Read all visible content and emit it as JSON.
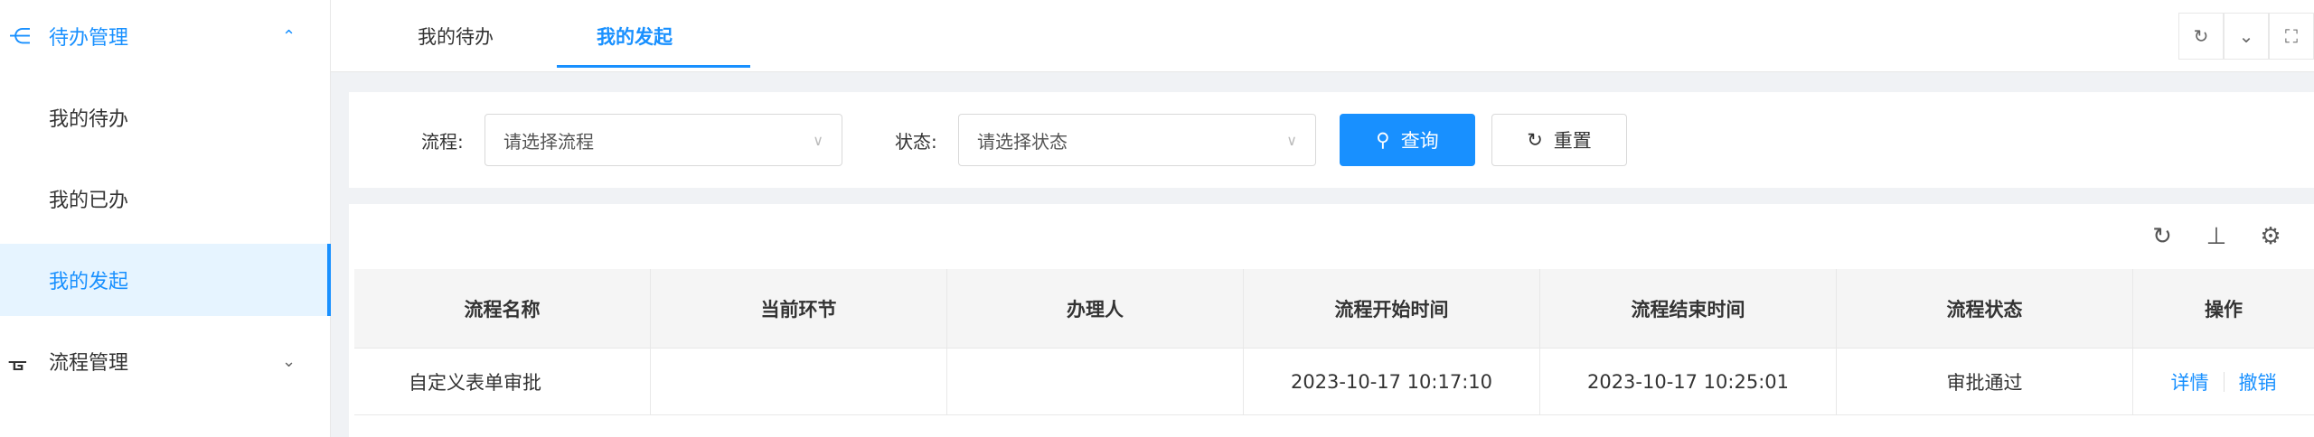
{
  "sidebar": {
    "groups": [
      {
        "label": "待办管理",
        "icon": "todo-list-icon",
        "expanded": true
      },
      {
        "label": "流程管理",
        "icon": "workflow-icon",
        "expanded": false
      }
    ],
    "items": [
      {
        "label": "我的待办"
      },
      {
        "label": "我的已办"
      },
      {
        "label": "我的发起"
      }
    ]
  },
  "tabs": [
    {
      "label": "我的待办"
    },
    {
      "label": "我的发起",
      "active": true
    }
  ],
  "filters": {
    "process_label": "流程:",
    "process_placeholder": "请选择流程",
    "status_label": "状态:",
    "status_placeholder": "请选择状态",
    "search_button": "查询",
    "reset_button": "重置"
  },
  "table": {
    "columns": [
      "流程名称",
      "当前环节",
      "办理人",
      "流程开始时间",
      "流程结束时间",
      "流程状态",
      "操作"
    ],
    "rows": [
      {
        "name": "自定义表单审批",
        "current_step": "",
        "handler": "",
        "start_time": "2023-10-17 10:17:10",
        "end_time": "2023-10-17 10:25:01",
        "status": "审批通过",
        "actions": [
          "详情",
          "撤销"
        ]
      }
    ]
  },
  "colors": {
    "accent": "#1890ff",
    "selected_bg": "#e6f4ff"
  }
}
